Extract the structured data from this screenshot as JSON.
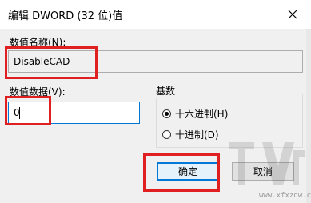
{
  "dialog": {
    "title": "编辑 DWORD (32 位)值",
    "value_name_label": "数值名称(N):",
    "value_name": "DisableCAD",
    "value_data_label": "数值数据(V):",
    "value_data": "0",
    "base_group_label": "基数",
    "radios": [
      {
        "label": "十六进制(H)",
        "checked": true
      },
      {
        "label": "十进制(D)",
        "checked": false
      }
    ],
    "ok_label": "确定",
    "cancel_label": "取消"
  },
  "watermark": {
    "url": "www.xfxzdw.com"
  },
  "icons": {
    "close": "close-icon",
    "watermark": "watermark-logo"
  },
  "colors": {
    "highlight": "#e02020",
    "focus": "#0078d7"
  }
}
